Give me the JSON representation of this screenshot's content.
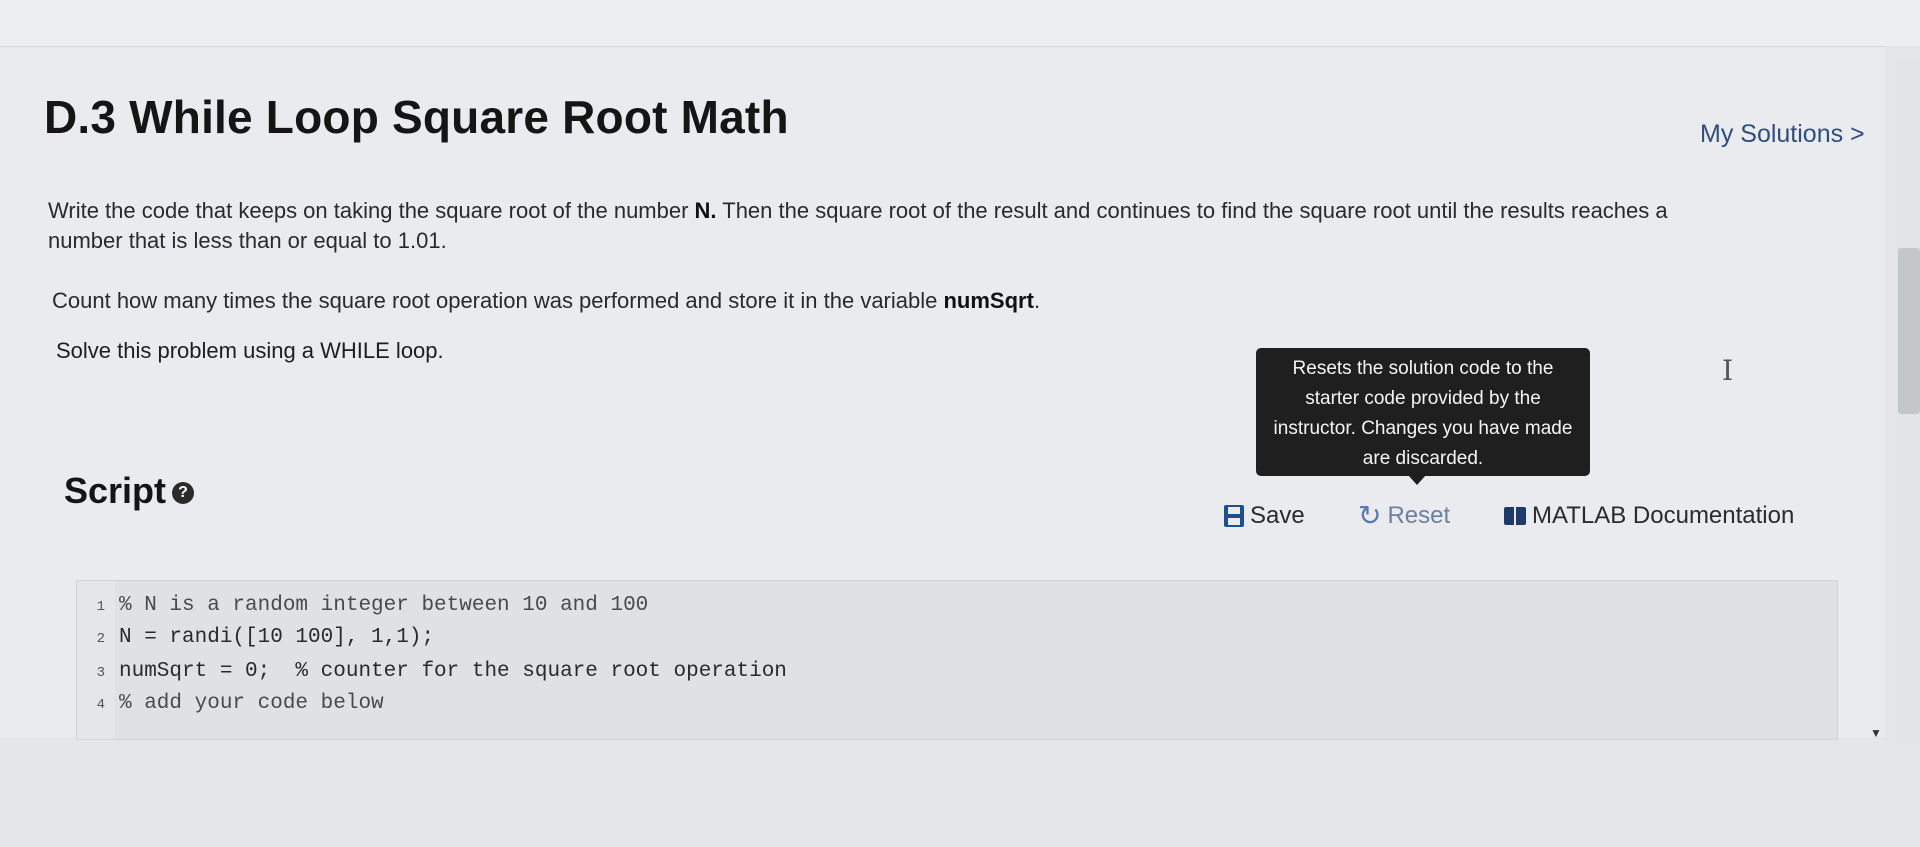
{
  "page": {
    "title": "D.3 While Loop Square Root Math",
    "my_solutions_label": "My Solutions >"
  },
  "problem": {
    "p1_a": "Write the code that keeps on taking the square root of the number ",
    "p1_b": "N.",
    "p1_c": " Then the square root of the result and continues to find the square root until the results reaches a number that is less than or equal to 1.01.",
    "p2_a": "Count how many times the square root operation was  performed and store it in the variable ",
    "p2_b": "numSqrt",
    "p2_c": ".",
    "p3": "Solve this problem using a WHILE loop."
  },
  "tooltip": {
    "text": "Resets the solution code to the starter code provided by the instructor. Changes you have made are discarded."
  },
  "script": {
    "heading": "Script",
    "help_icon": "?",
    "save_label": "Save",
    "reset_label": "Reset",
    "doc_label": "MATLAB Documentation",
    "icons": {
      "save": "save-icon",
      "reset": "reset-icon",
      "doc": "book-icon",
      "help": "question-circle-icon"
    }
  },
  "editor": {
    "lines": [
      {
        "num": "1",
        "code": "% N is a random integer between 10 and 100"
      },
      {
        "num": "2",
        "code": "N = randi([10 100], 1,1);"
      },
      {
        "num": "3",
        "code": "numSqrt = 0;  % counter for the square root operation"
      },
      {
        "num": "4",
        "code": "% add your code below"
      }
    ]
  }
}
